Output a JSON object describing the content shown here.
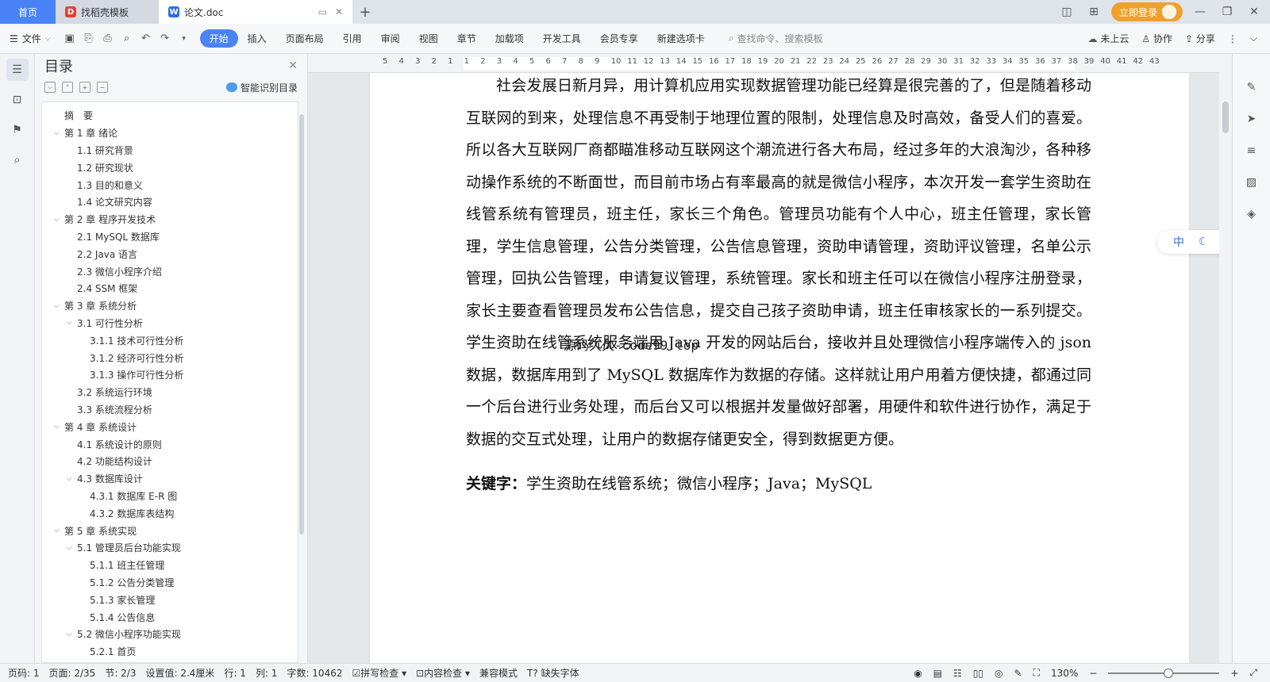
{
  "tabs": {
    "home": "首页",
    "templates": "找稻壳模板",
    "doc": "论文.doc",
    "add": "+"
  },
  "titlebar": {
    "login": "立即登录"
  },
  "toolbar": {
    "file": "文件",
    "menu": [
      "开始",
      "插入",
      "页面布局",
      "引用",
      "审阅",
      "视图",
      "章节",
      "加载项",
      "开发工具",
      "会员专享",
      "新建选项卡"
    ],
    "search_placeholder": "查找命令、搜索模板",
    "cloud": "未上云",
    "collab": "协作",
    "share": "分享"
  },
  "toc": {
    "title": "目录",
    "smart": "智能识别目录",
    "items": [
      {
        "level": 0,
        "chev": "",
        "text": "摘　要"
      },
      {
        "level": 0,
        "chev": "v",
        "text": "第 1 章  绪论"
      },
      {
        "level": 1,
        "chev": "",
        "text": "1.1  研究背景"
      },
      {
        "level": 1,
        "chev": "",
        "text": "1.2  研究现状"
      },
      {
        "level": 1,
        "chev": "",
        "text": "1.3  目的和意义"
      },
      {
        "level": 1,
        "chev": "",
        "text": "1.4  论文研究内容"
      },
      {
        "level": 0,
        "chev": "v",
        "text": "第 2 章  程序开发技术"
      },
      {
        "level": 1,
        "chev": "",
        "text": "2.1 MySQL 数据库"
      },
      {
        "level": 1,
        "chev": "",
        "text": "2.2 Java 语言"
      },
      {
        "level": 1,
        "chev": "",
        "text": "2.3  微信小程序介绍"
      },
      {
        "level": 1,
        "chev": "",
        "text": "2.4 SSM 框架"
      },
      {
        "level": 0,
        "chev": "v",
        "text": "第 3 章  系统分析"
      },
      {
        "level": 1,
        "chev": "v",
        "text": "3.1 可行性分析"
      },
      {
        "level": 2,
        "chev": "",
        "text": "3.1.1 技术可行性分析"
      },
      {
        "level": 2,
        "chev": "",
        "text": "3.1.2 经济可行性分析"
      },
      {
        "level": 2,
        "chev": "",
        "text": "3.1.3 操作可行性分析"
      },
      {
        "level": 1,
        "chev": "",
        "text": "3.2 系统运行环境"
      },
      {
        "level": 1,
        "chev": "",
        "text": "3.3 系统流程分析"
      },
      {
        "level": 0,
        "chev": "v",
        "text": "第 4 章  系统设计"
      },
      {
        "level": 1,
        "chev": "",
        "text": "4.1  系统设计的原则"
      },
      {
        "level": 1,
        "chev": "",
        "text": "4.2  功能结构设计"
      },
      {
        "level": 1,
        "chev": "v",
        "text": "4.3  数据库设计"
      },
      {
        "level": 2,
        "chev": "",
        "text": "4.3.1  数据库 E-R 图"
      },
      {
        "level": 2,
        "chev": "",
        "text": "4.3.2  数据库表结构"
      },
      {
        "level": 0,
        "chev": "v",
        "text": "第 5 章  系统实现"
      },
      {
        "level": 1,
        "chev": "v",
        "text": "5.1 管理员后台功能实现"
      },
      {
        "level": 2,
        "chev": "",
        "text": "5.1.1  班主任管理"
      },
      {
        "level": 2,
        "chev": "",
        "text": "5.1.2  公告分类管理"
      },
      {
        "level": 2,
        "chev": "",
        "text": "5.1.3  家长管理"
      },
      {
        "level": 2,
        "chev": "",
        "text": "5.1.4  公告信息"
      },
      {
        "level": 1,
        "chev": "v",
        "text": "5.2  微信小程序功能实现"
      },
      {
        "level": 2,
        "chev": "",
        "text": "5.2.1  首页"
      }
    ]
  },
  "ruler": [
    "5",
    "4",
    "3",
    "2",
    "1",
    "1",
    "2",
    "3",
    "4",
    "5",
    "6",
    "7",
    "8",
    "9",
    "10",
    "11",
    "12",
    "13",
    "14",
    "15",
    "16",
    "17",
    "18",
    "19",
    "20",
    "21",
    "22",
    "23",
    "24",
    "25",
    "26",
    "27",
    "28",
    "29",
    "30",
    "31",
    "32",
    "33",
    "34",
    "35",
    "36",
    "37",
    "38",
    "39",
    "40",
    "41",
    "42",
    "43"
  ],
  "document": {
    "paragraph": "社会发展日新月异，用计算机应用实现数据管理功能已经算是很完善的了，但是随着移动互联网的到来，处理信息不再受制于地理位置的限制，处理信息及时高效，备受人们的喜爱。所以各大互联网厂商都瞄准移动互联网这个潮流进行各大布局，经过多年的大浪淘沙，各种移动操作系统的不断面世，而目前市场占有率最高的就是微信小程序，本次开发一套学生资助在线管系统有管理员，班主任，家长三个角色。管理员功能有个人中心，班主任管理，家长管理，学生信息管理，公告分类管理，公告信息管理，资助申请管理，资助评议管理，名单公示管理，回执公告管理，申请复议管理，系统管理。家长和班主任可以在微信小程序注册登录，家长主要查看管理员发布公告信息，提交自己孩子资助申请，班主任审核家长的一系列提交。学生资助在线管系统服务端用 Java 开发的网站后台，接收并且处理微信小程序端传入的 json 数据，数据库用到了 MySQL 数据库作为数据的存储。这样就让用户用着方便快捷，都通过同一个后台进行业务处理，而后台又可以根据并发量做好部署，用硬件和软件进行协作，满足于数据的交互式处理，让用户的数据存储更安全，得到数据更方便。",
    "keywords_label": "关键字：",
    "keywords": "学生资助在线管系统；微信小程序；Java；MySQL",
    "watermark": "源码久久-code99.top"
  },
  "ime": {
    "lang": "中"
  },
  "status": {
    "page_no": "页码: 1",
    "pages": "页面: 2/35",
    "section": "节: 2/3",
    "setting": "设置值: 2.4厘米",
    "row": "行: 1",
    "col": "列: 1",
    "words": "字数: 10462",
    "spell": "拼写检查",
    "content": "内容检查",
    "compat": "兼容模式",
    "font": "缺失字体",
    "zoom": "130%"
  }
}
